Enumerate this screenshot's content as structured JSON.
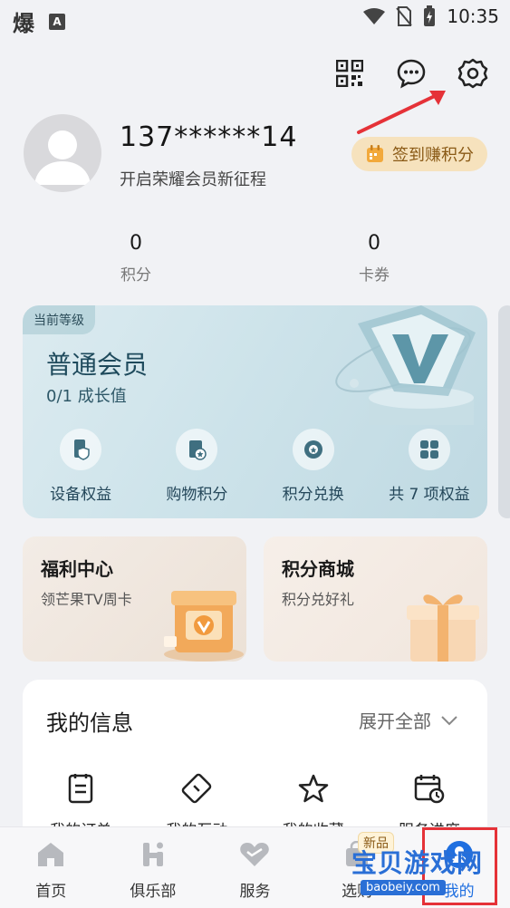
{
  "status_bar": {
    "app_glyph": "爆",
    "a_badge": "A",
    "time": "10:35"
  },
  "header": {
    "icons": [
      "qr-code-icon",
      "message-icon",
      "settings-icon"
    ]
  },
  "profile": {
    "phone": "137******14",
    "subtitle": "开启荣耀会员新征程",
    "signin_label": "签到赚积分"
  },
  "stats": [
    {
      "value": "0",
      "label": "积分"
    },
    {
      "value": "0",
      "label": "卡券"
    }
  ],
  "level": {
    "tag": "当前等级",
    "name": "普通会员",
    "growth": "0/1 成长值",
    "benefits": [
      {
        "label": "设备权益",
        "icon": "device-icon"
      },
      {
        "label": "购物积分",
        "icon": "shopping-points-icon"
      },
      {
        "label": "积分兑换",
        "icon": "exchange-icon"
      },
      {
        "label": "共 7 项权益",
        "icon": "grid-icon"
      }
    ]
  },
  "promos": [
    {
      "title": "福利中心",
      "subtitle": "领芒果TV周卡"
    },
    {
      "title": "积分商城",
      "subtitle": "积分兑好礼"
    }
  ],
  "info": {
    "title": "我的信息",
    "expand_label": "展开全部",
    "items": [
      {
        "label": "我的订单",
        "icon": "order-icon"
      },
      {
        "label": "我的互动",
        "icon": "interaction-icon"
      },
      {
        "label": "我的收藏",
        "icon": "star-icon"
      },
      {
        "label": "服务进度",
        "icon": "calendar-clock-icon"
      }
    ]
  },
  "tabbar": {
    "tabs": [
      {
        "label": "首页",
        "icon": "home-icon"
      },
      {
        "label": "俱乐部",
        "icon": "club-icon"
      },
      {
        "label": "服务",
        "icon": "heart-icon"
      },
      {
        "label": "选购",
        "icon": "shop-icon"
      },
      {
        "label": "我的",
        "icon": "profile-icon"
      }
    ],
    "new_badge": "新品",
    "active_index": 4
  },
  "watermark": {
    "title": "宝贝游戏网",
    "url": "baobeiy.com"
  },
  "colors": {
    "accent": "#1f6fe0",
    "annotation_red": "#e53238",
    "signin_bg": "#f6e2bd"
  }
}
